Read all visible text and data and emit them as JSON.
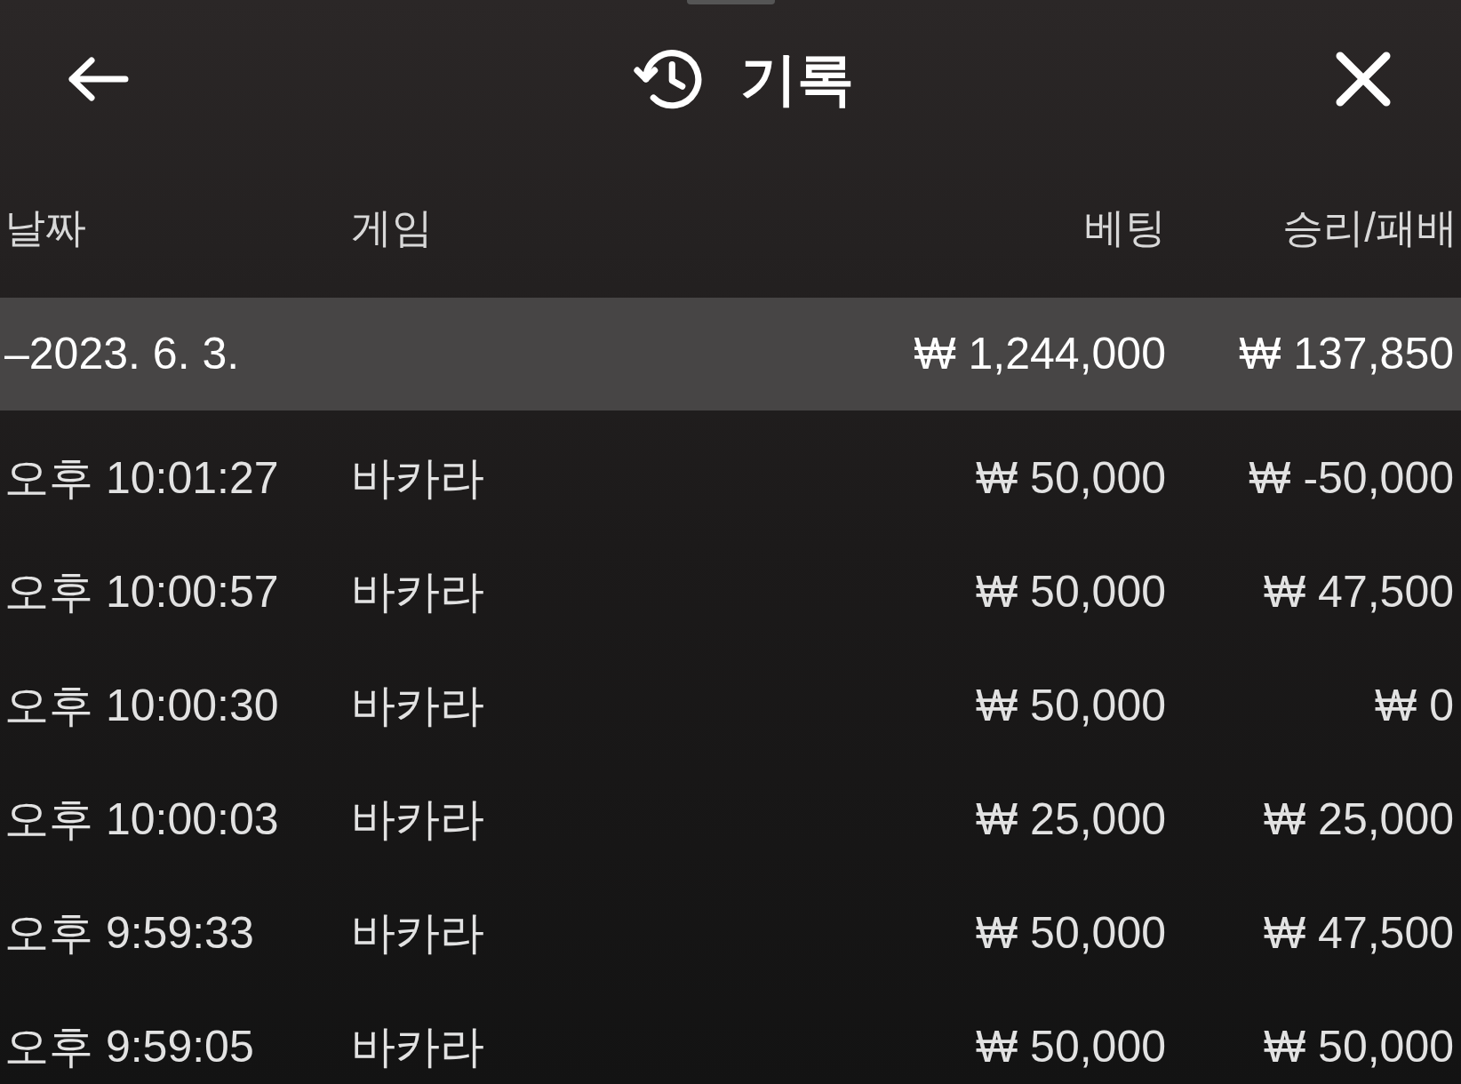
{
  "header": {
    "title": "기록"
  },
  "table": {
    "columns": [
      "날짜",
      "게임",
      "베팅",
      "승리/패배"
    ],
    "summary": {
      "date": "–2023. 6. 3.",
      "bet": "₩ 1,244,000",
      "result": "₩ 137,850"
    },
    "rows": [
      {
        "time": "오후 10:01:27",
        "game": "바카라",
        "bet": "₩ 50,000",
        "result": "₩ -50,000"
      },
      {
        "time": "오후 10:00:57",
        "game": "바카라",
        "bet": "₩ 50,000",
        "result": "₩ 47,500"
      },
      {
        "time": "오후 10:00:30",
        "game": "바카라",
        "bet": "₩ 50,000",
        "result": "₩ 0"
      },
      {
        "time": "오후 10:00:03",
        "game": "바카라",
        "bet": "₩ 25,000",
        "result": "₩ 25,000"
      },
      {
        "time": "오후 9:59:33",
        "game": "바카라",
        "bet": "₩ 50,000",
        "result": "₩ 47,500"
      },
      {
        "time": "오후 9:59:05",
        "game": "바카라",
        "bet": "₩ 50,000",
        "result": "₩ 50,000"
      }
    ]
  }
}
